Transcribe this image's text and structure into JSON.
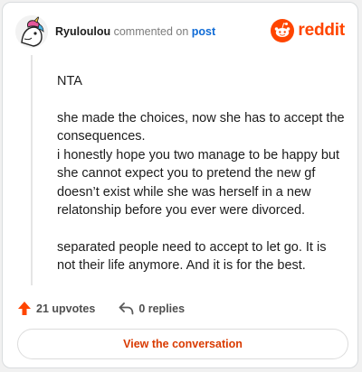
{
  "header": {
    "username": "Ryuloulou",
    "connector": "commented on",
    "post_link": "post",
    "brand": "reddit"
  },
  "comment": {
    "paragraphs": [
      [
        "NTA"
      ],
      [
        "she made the choices, now she has to accept the",
        "consequences.",
        "i honestly hope you two manage to be happy but",
        "she cannot expect you to pretend the new gf",
        "doesn’t exist while she was herself in a new",
        "relatonship before you ever were divorced."
      ],
      [
        "separated people need to accept to let go. It is",
        "not their life anymore. And it is for the best."
      ]
    ]
  },
  "actions": {
    "upvotes": "21 upvotes",
    "replies": "0 replies"
  },
  "view_button": "View the conversation",
  "colors": {
    "brand": "#ff4500",
    "link": "#0f6bd6",
    "button_text": "#d93a00"
  },
  "icons": [
    "avatar",
    "reddit-logo-icon",
    "upvote-arrow-icon",
    "reply-icon"
  ]
}
